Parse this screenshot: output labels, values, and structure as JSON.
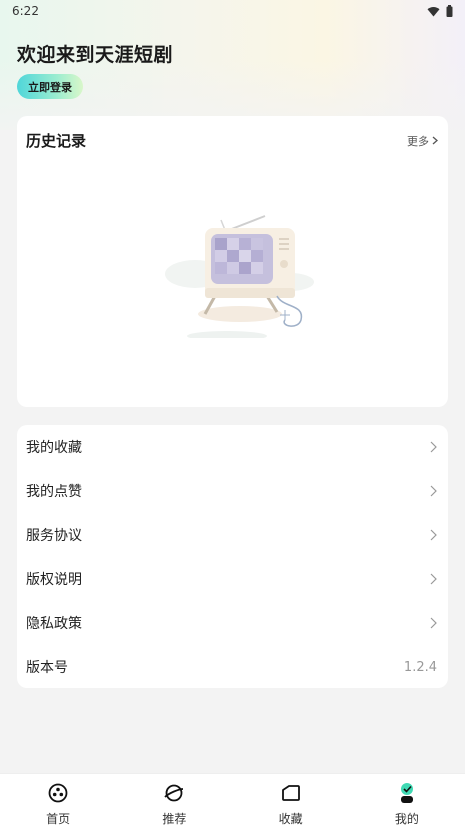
{
  "status_bar": {
    "time": "6:22"
  },
  "header": {
    "title": "欢迎来到天涯短剧",
    "login_label": "立即登录"
  },
  "history": {
    "title": "历史记录",
    "more_label": "更多"
  },
  "menu": {
    "items": [
      {
        "label": "我的收藏"
      },
      {
        "label": "我的点赞"
      },
      {
        "label": "服务协议"
      },
      {
        "label": "版权说明"
      },
      {
        "label": "隐私政策"
      }
    ],
    "version_label": "版本号",
    "version_value": "1.2.4"
  },
  "tabs": [
    {
      "label": "首页",
      "icon": "film-reel-icon"
    },
    {
      "label": "推荐",
      "icon": "planet-icon"
    },
    {
      "label": "收藏",
      "icon": "folder-icon"
    },
    {
      "label": "我的",
      "icon": "profile-icon"
    }
  ],
  "colors": {
    "login_gradient_start": "#4fd6d9",
    "login_gradient_end": "#d9f7c9",
    "page_background": "#f3f3f3",
    "active_tab_accent": "#3fd9b3"
  }
}
